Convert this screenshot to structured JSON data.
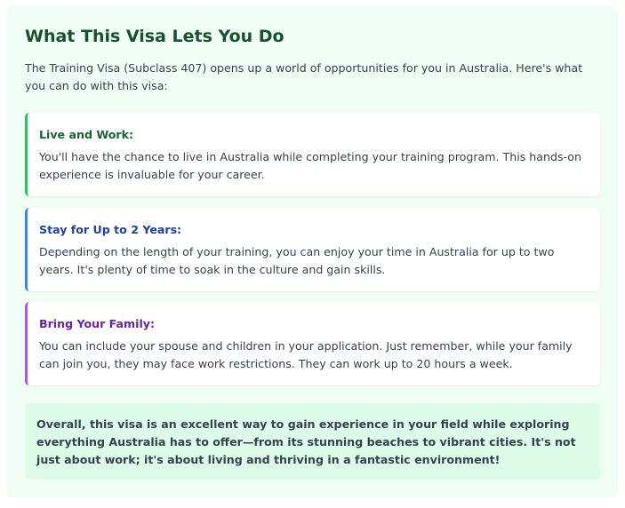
{
  "section": {
    "title": "What This Visa Lets You Do",
    "intro": "The Training Visa (Subclass 407) opens up a world of opportunities for you in Australia. Here's what you can do with this visa:"
  },
  "benefits": [
    {
      "title": "Live and Work:",
      "body": "You'll have the chance to live in Australia while completing your training program. This hands-on experience is invaluable for your career.",
      "accent_color": "#22c55e"
    },
    {
      "title": "Stay for Up to 2 Years:",
      "body": "Depending on the length of your training, you can enjoy your time in Australia for up to two years. It's plenty of time to soak in the culture and gain skills.",
      "accent_color": "#3b82f6"
    },
    {
      "title": "Bring Your Family:",
      "body": "You can include your spouse and children in your application. Just remember, while your family can join you, they may face work restrictions. They can work up to 20 hours a week.",
      "accent_color": "#a855f7"
    }
  ],
  "summary": {
    "text": "Overall, this visa is an excellent way to gain experience in your field while exploring everything Australia has to offer—from its stunning beaches to vibrant cities. It's not just about work; it's about living and thriving in a fantastic environment!"
  },
  "colors": {
    "panel_background": "#f0fdf4",
    "title": "#14532d",
    "summary_background": "#dcfce7"
  }
}
